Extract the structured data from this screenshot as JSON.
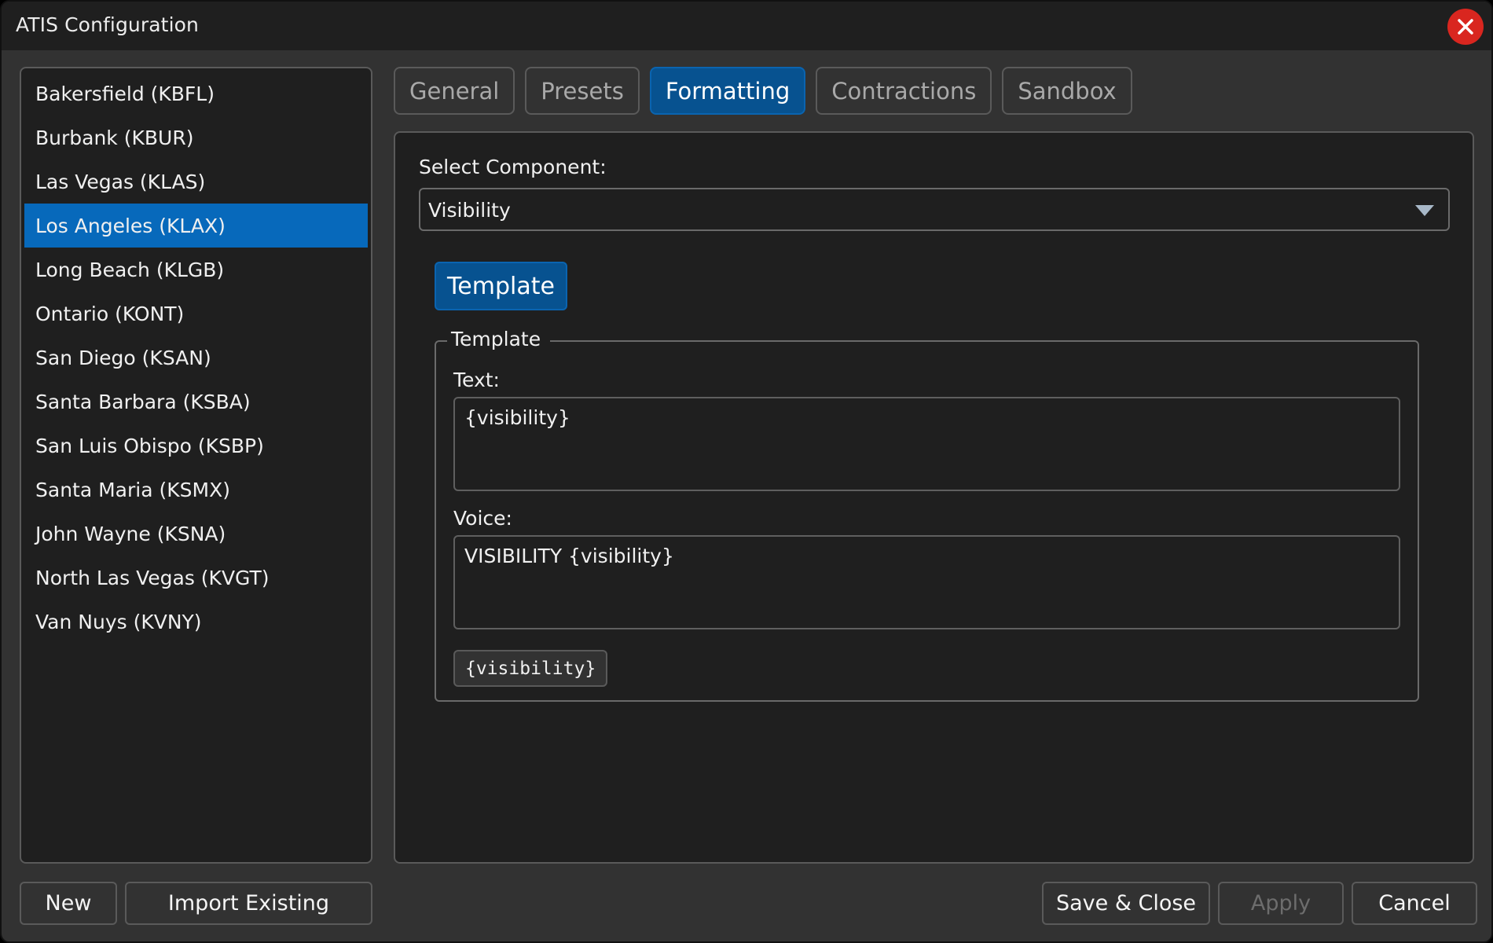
{
  "window": {
    "title": "ATIS Configuration",
    "close_icon": "close-circle-icon"
  },
  "stations": {
    "selected_index": 3,
    "items": [
      {
        "label": "Bakersfield (KBFL)"
      },
      {
        "label": "Burbank (KBUR)"
      },
      {
        "label": "Las Vegas (KLAS)"
      },
      {
        "label": "Los Angeles (KLAX)"
      },
      {
        "label": "Long Beach (KLGB)"
      },
      {
        "label": "Ontario (KONT)"
      },
      {
        "label": "San Diego (KSAN)"
      },
      {
        "label": "Santa Barbara (KSBA)"
      },
      {
        "label": "San Luis Obispo (KSBP)"
      },
      {
        "label": "Santa Maria (KSMX)"
      },
      {
        "label": "John Wayne (KSNA)"
      },
      {
        "label": "North Las Vegas (KVGT)"
      },
      {
        "label": "Van Nuys (KVNY)"
      }
    ]
  },
  "tabs": {
    "active": "Formatting",
    "items": [
      {
        "label": "General"
      },
      {
        "label": "Presets"
      },
      {
        "label": "Formatting"
      },
      {
        "label": "Contractions"
      },
      {
        "label": "Sandbox"
      }
    ]
  },
  "formatting": {
    "select_label": "Select Component:",
    "selected_component": "Visibility",
    "subtab_label": "Template",
    "group_title": "Template",
    "text_label": "Text:",
    "text_value": "{visibility}",
    "voice_label": "Voice:",
    "voice_value": "VISIBILITY {visibility}",
    "variable_chip": "{visibility}"
  },
  "footer": {
    "new_label": "New",
    "import_label": "Import Existing",
    "save_close_label": "Save & Close",
    "apply_label": "Apply",
    "apply_enabled": false,
    "cancel_label": "Cancel"
  },
  "colors": {
    "accent": "#0769bb",
    "tab_active": "#075290",
    "close": "#d9261f",
    "background": "#323232",
    "panel": "#1f1f1f"
  }
}
